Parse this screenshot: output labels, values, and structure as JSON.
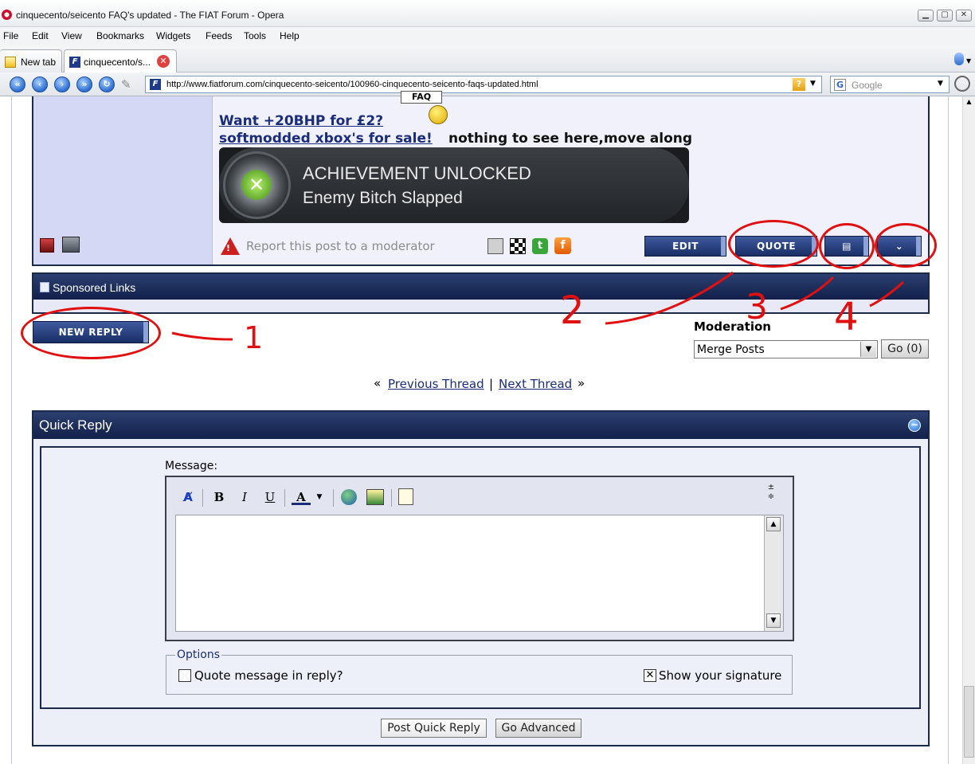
{
  "window": {
    "title": "cinquecento/seicento FAQ's updated - The FIAT Forum - Opera"
  },
  "menu": [
    "File",
    "Edit",
    "View",
    "Bookmarks",
    "Widgets",
    "Feeds",
    "Tools",
    "Help"
  ],
  "tabs": [
    {
      "label": "New tab"
    },
    {
      "label": "cinquecento/s..."
    }
  ],
  "address": {
    "url": "http://www.fiatforum.com/cinquecento-seicento/100960-cinquecento-seicento-faqs-updated.html",
    "search_placeholder": "Google"
  },
  "post": {
    "faq_sign": "FAQ",
    "sig_link_1": "Want +20BHP for £2?",
    "sig_link_2": "softmodded xbox's for sale!",
    "sig_text": "nothing to see here,move along",
    "achievement_title": "ACHIEVEMENT UNLOCKED",
    "achievement_sub": "Enemy Bitch Slapped",
    "report_text": "Report this post to a moderator",
    "edit_label": "EDIT",
    "quote_label": "QUOTE"
  },
  "sponsored": {
    "label": "Sponsored Links"
  },
  "new_reply_label": "NEW REPLY",
  "annotations": {
    "a1": "1",
    "a2": "2",
    "a3": "3",
    "a4": "4"
  },
  "moderation": {
    "label": "Moderation",
    "selected": "Merge Posts",
    "go_label": "Go (0)"
  },
  "thread_nav": {
    "prev": "Previous Thread",
    "next": "Next Thread",
    "sep": "|",
    "left_quote": "«",
    "right_quote": "»"
  },
  "quick_reply": {
    "title": "Quick Reply",
    "message_label": "Message:",
    "options_legend": "Options",
    "quote_option": "Quote message in reply?",
    "signature_option": "Show your signature",
    "post_button": "Post Quick Reply",
    "advanced_button": "Go Advanced"
  }
}
